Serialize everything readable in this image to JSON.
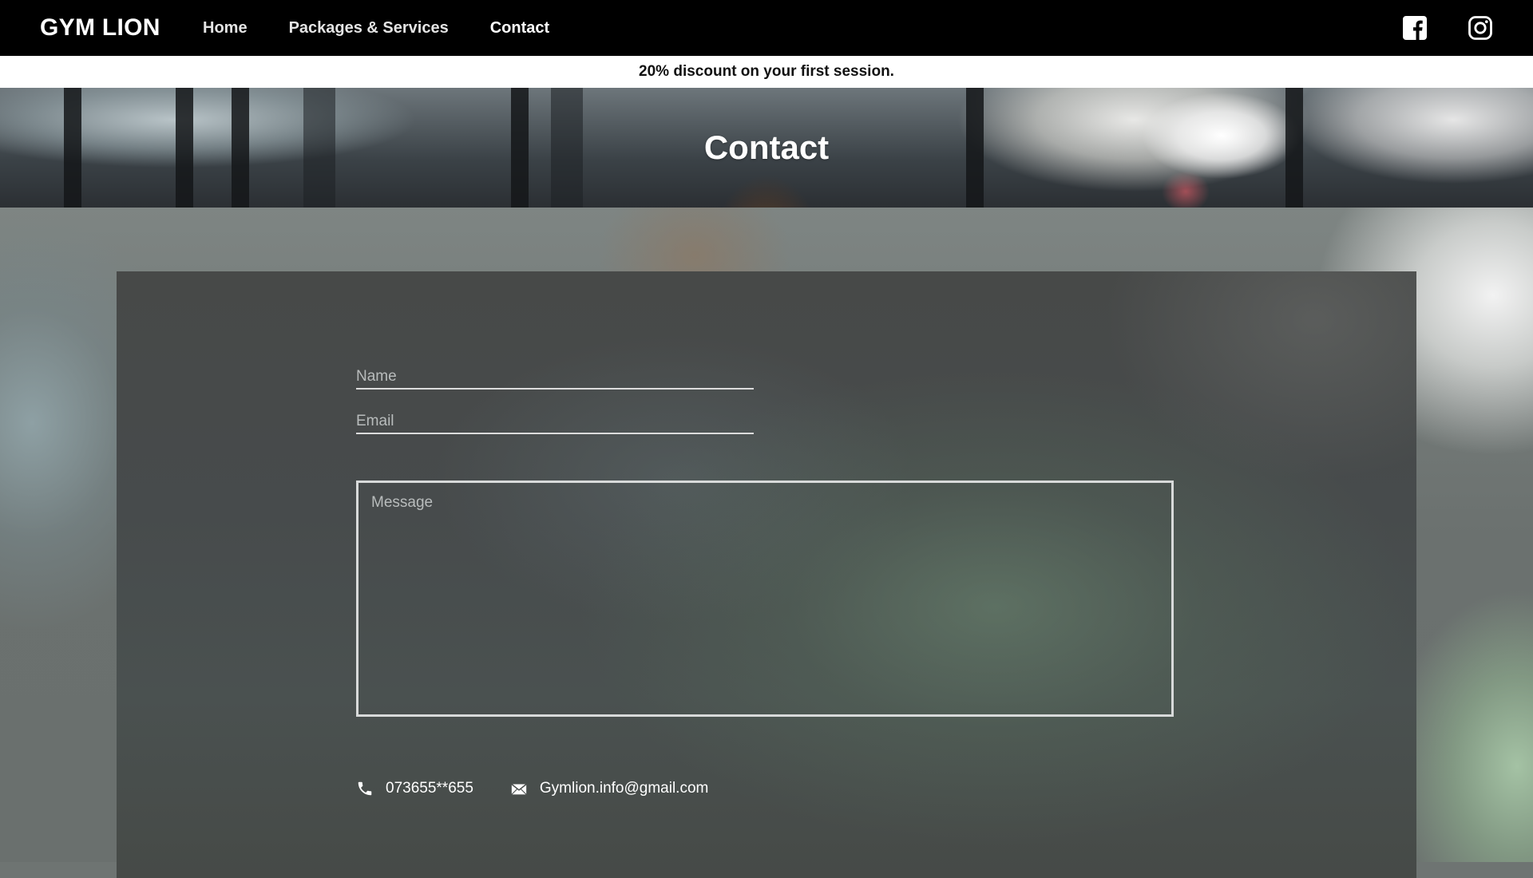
{
  "brand": "GYM LION",
  "nav": {
    "items": [
      {
        "label": "Home"
      },
      {
        "label": "Packages & Services"
      },
      {
        "label": "Contact"
      }
    ],
    "active": "Contact"
  },
  "social": {
    "icons": [
      "facebook-icon",
      "instagram-icon"
    ]
  },
  "promo": {
    "text": "20% discount on your first session."
  },
  "hero": {
    "title": "Contact"
  },
  "form": {
    "name_placeholder": "Name",
    "name_value": "",
    "email_placeholder": "Email",
    "email_value": "",
    "message_placeholder": "Message",
    "message_value": ""
  },
  "contact": {
    "phone": "073655**655",
    "phone_icon": "phone-icon",
    "email": "Gymlion.info@gmail.com",
    "email_icon": "envelope-icon"
  },
  "colors": {
    "navbar_bg": "#000000",
    "promo_bg": "#ffffff",
    "text_light": "#ffffff",
    "field_line": "#dcdcdc"
  }
}
